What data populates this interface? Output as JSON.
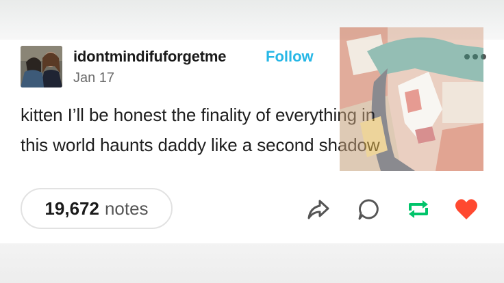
{
  "post": {
    "username": "idontmindifuforgetme",
    "follow_label": "Follow",
    "date": "Jan 17",
    "text_lines": [
      "kitten I’ll be honest the finality of everything in",
      "this world haunts daddy like a second shadow"
    ]
  },
  "footer": {
    "notes_count": "19,672",
    "notes_label": "notes"
  },
  "colors": {
    "follow": "#27b7e6",
    "reblog": "#00c46a",
    "like": "#ff4930"
  },
  "icons": {
    "more": "more-options-icon",
    "share": "share-icon",
    "reply": "reply-icon",
    "reblog": "reblog-icon",
    "like": "heart-icon"
  }
}
